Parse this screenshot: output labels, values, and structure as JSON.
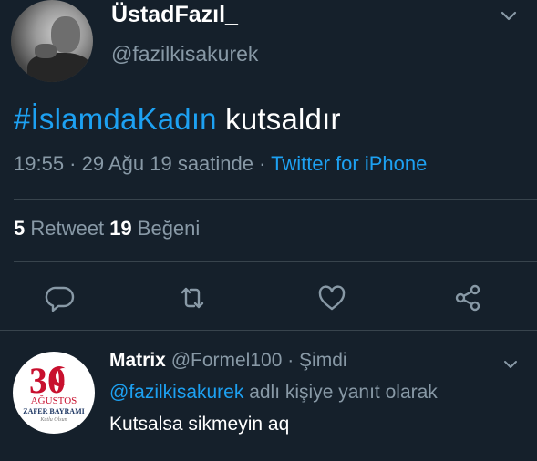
{
  "tweet": {
    "display_name": "ÜstadFazıl_",
    "handle": "@fazilkisakurek",
    "hashtag": "#İslamdaKadın",
    "text": " kutsaldır",
    "timestamp": "19:55 · 29 Ağu 19 saatinde · ",
    "source": "Twitter for iPhone",
    "retweet_count": "5",
    "retweet_label": " Retweet ",
    "like_count": "19",
    "like_label": " Beğeni"
  },
  "reply": {
    "display_name": "Matrix",
    "handle_time": " @Formel100 · Şimdi",
    "replying_mention": "@fazilkisakurek",
    "replying_suffix": " adlı kişiye yanıt olarak",
    "text": "Kutsalsa sikmeyin aq",
    "avatar_texts": {
      "number": "30",
      "month": "AĞUSTOS",
      "title": "ZAFER BAYRAMI",
      "tagline": "Kutlu Olsun"
    }
  },
  "icons": [
    "chevron-down-icon",
    "reply-icon",
    "retweet-icon",
    "like-icon",
    "share-icon"
  ],
  "colors": {
    "background": "#15202b",
    "accent": "#1da1f2",
    "secondary_text": "#8899a6",
    "divider": "#38444d"
  }
}
